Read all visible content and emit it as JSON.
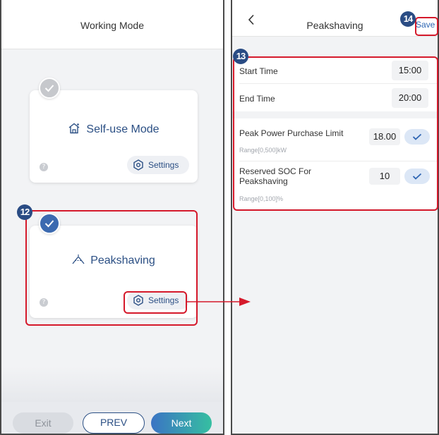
{
  "left_screen": {
    "title": "Working Mode",
    "modes": [
      {
        "name": "Self-use Mode",
        "selected": false,
        "icon": "house-icon",
        "settings_label": "Settings",
        "help": "?"
      },
      {
        "name": "Peakshaving",
        "selected": true,
        "icon": "peakshaving-icon",
        "settings_label": "Settings",
        "help": "?"
      }
    ],
    "footer": {
      "exit_label": "Exit",
      "prev_label": "PREV",
      "next_label": "Next"
    }
  },
  "right_screen": {
    "back_icon": "chevron-left-icon",
    "title": "Peakshaving",
    "save_label": "Save",
    "fields": {
      "start_time": {
        "label": "Start Time",
        "value": "15:00"
      },
      "end_time": {
        "label": "End Time",
        "value": "20:00"
      },
      "peak_power_limit": {
        "label": "Peak Power Purchase Limit",
        "value": "18.00",
        "range": "Range[0,500]kW"
      },
      "reserved_soc": {
        "label_line1": "Reserved SOC For",
        "label_line2": "Peakshaving",
        "value": "10",
        "range": "Range[0,100]%"
      }
    }
  },
  "annotations": {
    "badge_12": "12",
    "badge_13": "13",
    "badge_14": "14"
  },
  "colors": {
    "accent": "#2b4f84",
    "selected_check": "#3c6ab0",
    "unselected_check": "#c6c8cc",
    "annotation": "#d5192b",
    "next_gradient_start": "#3b74c4",
    "next_gradient_end": "#36bfa1"
  }
}
